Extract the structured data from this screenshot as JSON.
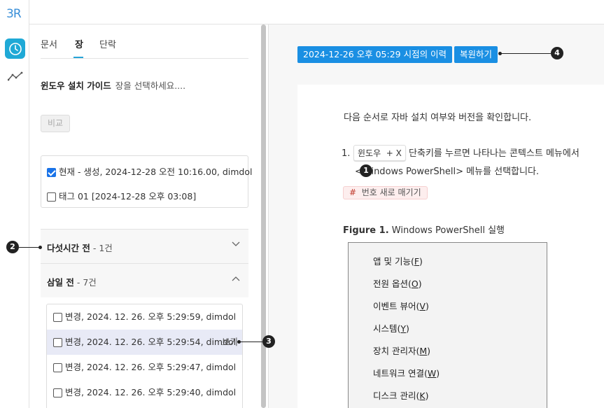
{
  "app": {
    "logo": "3R"
  },
  "rail": {
    "history_icon": "clock-icon",
    "stats_icon": "line-chart-icon"
  },
  "tabs": [
    {
      "label": "문서"
    },
    {
      "label": "장"
    },
    {
      "label": "단락"
    }
  ],
  "doc_selector": {
    "document": "윈도우 설치 가이드",
    "hint": "장을 선택하세요...."
  },
  "compare_label": "비교",
  "current": {
    "row1": "현재 - 생성, 2024-12-28 오전 10:16.00, dimdol",
    "row2": "태그 01 [2024-12-28 오후 03:08]"
  },
  "groups": [
    {
      "title": "다섯시간 전",
      "count": " - 1건"
    },
    {
      "title": "삼일 전",
      "count": " - 7건"
    }
  ],
  "changes": [
    {
      "label": "변경, 2024. 12. 26. 오후 5:29:59, dimdol"
    },
    {
      "label": "변경, 2024. 12. 26. 오후 5:29:54, dimdol",
      "action": "보기"
    },
    {
      "label": "변경, 2024. 12. 26. 오후 5:29:47, dimdol"
    },
    {
      "label": "변경, 2024. 12. 26. 오후 5:29:40, dimdol"
    }
  ],
  "preview": {
    "date_label": "2024-12-26 오후 05:29 시점의 이력",
    "restore_label": "복원하기",
    "intro": "다음 순서로 자바 설치 여부와 버전을 확인합니다.",
    "step_num": "1.",
    "key1": "윈도우",
    "plus": "+",
    "key2": "X",
    "step_text1": "단축키를 누르면 나타나는 콘텍스트 메뉴에서",
    "step_text2": "<Windows PowerShell> 메뉴를 선택합니다.",
    "tag_hash": "#",
    "tag_text": "번호 새로 매기기",
    "fig_label": "Figure 1.",
    "fig_title": "Windows PowerShell 실행",
    "menu": [
      {
        "text": "앱 및 기능",
        "key": "F"
      },
      {
        "text": "전원 옵션",
        "key": "O"
      },
      {
        "text": "이벤트 뷰어",
        "key": "V"
      },
      {
        "text": "시스템",
        "key": "Y"
      },
      {
        "text": "장치 관리자",
        "key": "M"
      },
      {
        "text": "네트워크 연결",
        "key": "W"
      },
      {
        "text": "디스크 관리",
        "key": "K"
      }
    ]
  },
  "callouts": [
    "1",
    "2",
    "3",
    "4"
  ],
  "colors": {
    "accent": "#1a8fe3",
    "rail_active": "#1fa9d6",
    "tag_bg": "#fdeeee"
  }
}
